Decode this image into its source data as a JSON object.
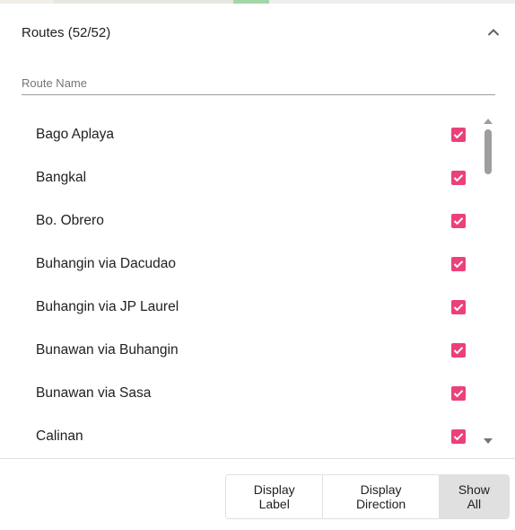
{
  "panel": {
    "title": "Routes (52/52)",
    "collapse_icon": "chevron-up-icon"
  },
  "search": {
    "placeholder": "Route Name",
    "value": ""
  },
  "routes": [
    {
      "label": "Bago Aplaya",
      "checked": true
    },
    {
      "label": "Bangkal",
      "checked": true
    },
    {
      "label": "Bo. Obrero",
      "checked": true
    },
    {
      "label": "Buhangin via Dacudao",
      "checked": true
    },
    {
      "label": "Buhangin via JP Laurel",
      "checked": true
    },
    {
      "label": "Bunawan via Buhangin",
      "checked": true
    },
    {
      "label": "Bunawan via Sasa",
      "checked": true
    },
    {
      "label": "Calinan",
      "checked": true
    }
  ],
  "toolbar": {
    "display_label": "Display Label",
    "display_direction": "Display Direction",
    "show_all": "Show All"
  },
  "colors": {
    "checkbox": "#ec407a",
    "active_button": "#e0e0e0"
  }
}
